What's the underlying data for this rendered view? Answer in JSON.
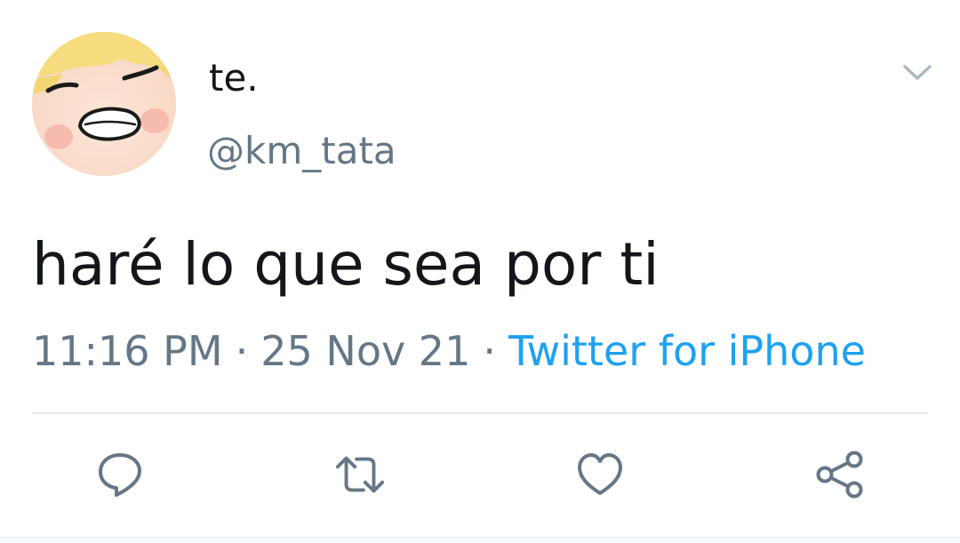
{
  "user": {
    "display_name": "te.",
    "handle": "@km_tata"
  },
  "tweet": {
    "text": "haré lo que sea por ti"
  },
  "meta": {
    "time": "11:16 PM",
    "separator": "·",
    "date": "25 Nov 21",
    "source": "Twitter for iPhone"
  },
  "icons": {
    "menu": "chevron-down-icon",
    "reply": "reply-icon",
    "retweet": "retweet-icon",
    "like": "heart-icon",
    "share": "share-icon"
  },
  "colors": {
    "text": "#14171a",
    "secondary": "#657786",
    "link": "#1da1f2",
    "icon": "#657786",
    "divider": "#e1e8ed"
  }
}
